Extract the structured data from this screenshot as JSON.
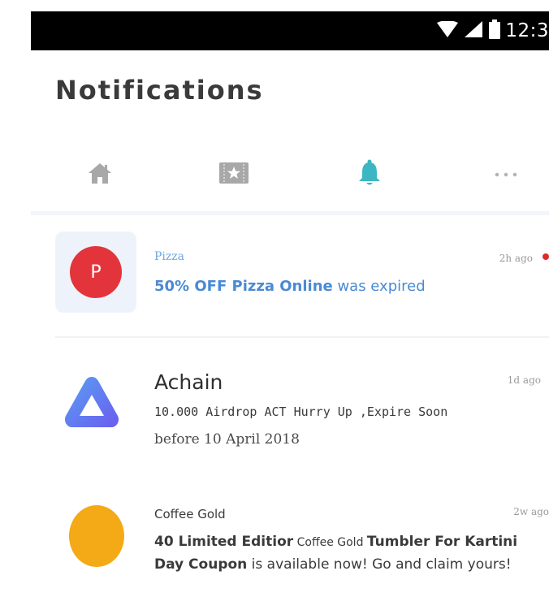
{
  "status_bar": {
    "time": "12:3",
    "icons": [
      "wifi-icon",
      "cellular-signal-icon",
      "battery-icon"
    ]
  },
  "header": {
    "title": "Notifications"
  },
  "tabs": [
    {
      "name": "home-icon",
      "active": false
    },
    {
      "name": "ticket-icon",
      "active": false
    },
    {
      "name": "bell-icon",
      "active": true
    },
    {
      "name": "more-icon",
      "active": false
    }
  ],
  "colors": {
    "accent": "#3bb7c4",
    "inactive_icon": "#a8a8a8",
    "link_blue": "#4a8ad4",
    "unread": "#e02b2b"
  },
  "notifications": [
    {
      "source": "Pizza",
      "avatar_letter": "P",
      "time": "2h ago",
      "unread": true,
      "message_bold": "50% OFF Pizza Online",
      "message_rest": " was expired"
    },
    {
      "source": "Achain",
      "time": "1d ago",
      "line1": "10.000 Airdrop ACT Hurry Up ,Expire Soon",
      "line2": "before 10 April 2018"
    },
    {
      "source": "Coffee Gold",
      "time": "2w ago",
      "part1_bold": "40 Limited Editior",
      "part2": " Coffee Gold ",
      "part3_bold": "Tumbler For Kartini",
      "part4_bold": "Day Coupon",
      "part5": " is available now! Go and claim yours!"
    }
  ]
}
